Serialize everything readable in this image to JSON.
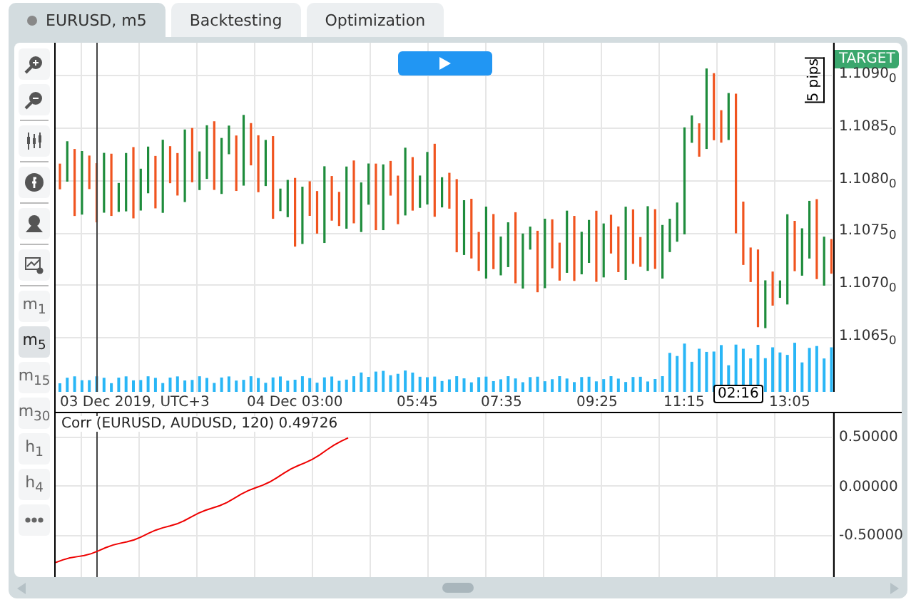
{
  "tabs": [
    {
      "label": "EURUSD, m5",
      "selected": true
    },
    {
      "label": "Backtesting",
      "selected": false
    },
    {
      "label": "Optimization",
      "selected": false
    }
  ],
  "timeframes": [
    {
      "label": "m$_{1}$",
      "selected": false
    },
    {
      "label": "m$_{5}$",
      "selected": true
    },
    {
      "label": "m$_{15}$",
      "selected": false
    },
    {
      "label": "m$_{30}$",
      "selected": false
    },
    {
      "label": "h$_{1}$",
      "selected": false
    },
    {
      "label": "h$_{4}$",
      "selected": false
    }
  ],
  "chart": {
    "pips_label": "5 pips",
    "target_label": "TARGET",
    "price_ticks": [
      "1.1090$_{0}$",
      "1.1085$_{0}$",
      "1.1080$_{0}$",
      "1.1075$_{0}$",
      "1.1070$_{0}$",
      "1.1065$_{0}$"
    ],
    "time_ticks": [
      "03 Dec 2019, UTC+3",
      "04 Dec 03:00",
      "05:45",
      "07:35",
      "09:25",
      "11:15",
      "13:05"
    ],
    "cursor_time": "02:16"
  },
  "indicator": {
    "label": "Corr (EURUSD, AUDUSD, 120) 0.49726",
    "ticks": [
      "0.50000",
      "0.00000",
      "-0.50000"
    ]
  }
}
